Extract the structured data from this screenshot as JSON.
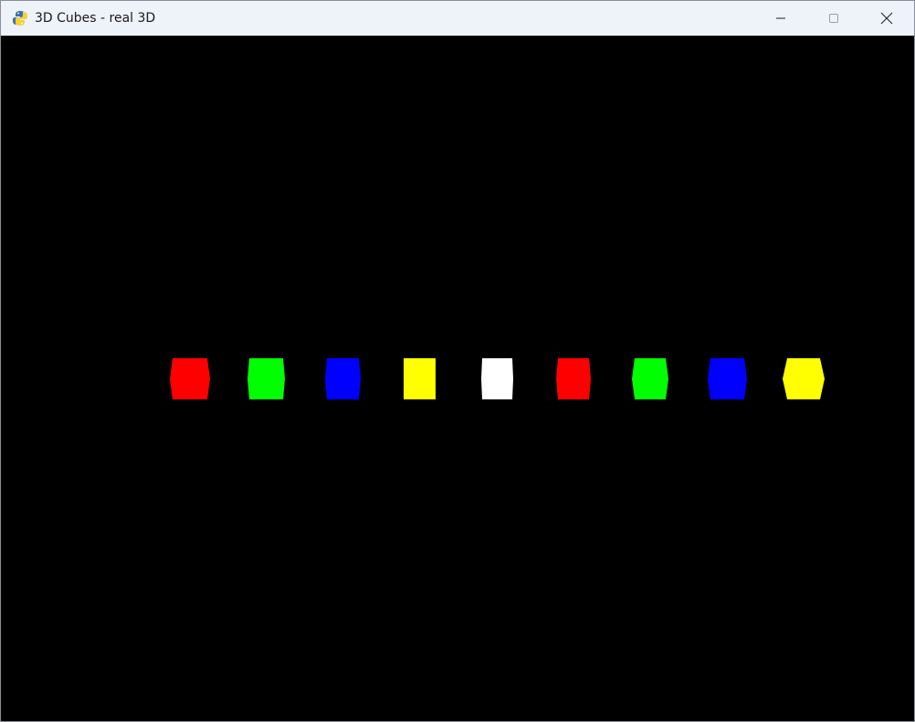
{
  "window": {
    "title": "3D Cubes - real 3D",
    "app_icon": "python-snake-icon",
    "controls": {
      "minimize_icon": "minimize-icon",
      "maximize_icon": "maximize-icon",
      "close_icon": "close-icon"
    }
  },
  "scene": {
    "background": "#000000",
    "cubes": [
      {
        "color": "#ff0000"
      },
      {
        "color": "#00ff00"
      },
      {
        "color": "#0000ff"
      },
      {
        "color": "#ffff00"
      },
      {
        "color": "#ffffff"
      },
      {
        "color": "#ff0000"
      },
      {
        "color": "#00ff00"
      },
      {
        "color": "#0000ff"
      },
      {
        "color": "#ffff00"
      }
    ]
  }
}
